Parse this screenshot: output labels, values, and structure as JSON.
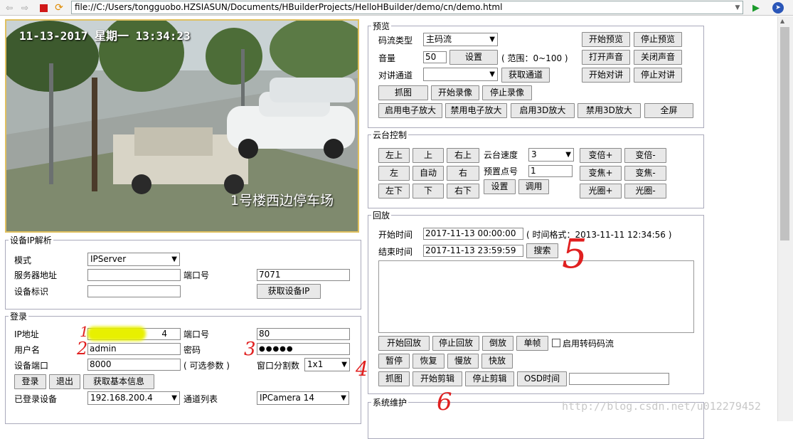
{
  "browser": {
    "url": "file://C:/Users/tongguobo.HZSIASUN/Documents/HBuilderProjects/HelloHBuilder/demo/cn/demo.html",
    "icons": [
      "back-arrow-icon",
      "forward-arrow-icon",
      "stop-icon",
      "refresh-icon",
      "dropdown-icon",
      "play-icon",
      "hbuilder-logo-icon"
    ]
  },
  "video": {
    "timestamp": "11-13-2017 星期一 13:34:23",
    "caption": "1号楼西边停车场"
  },
  "device_ip": {
    "legend": "设备IP解析",
    "mode_label": "模式",
    "mode_value": "IPServer",
    "server_label": "服务器地址",
    "server_value": "",
    "port_label": "端口号",
    "port_value": "7071",
    "id_label": "设备标识",
    "id_value": "",
    "get_ip_btn": "获取设备IP"
  },
  "login": {
    "legend": "登录",
    "ip_label": "IP地址",
    "ip_value": "4",
    "port_label": "端口号",
    "port_value": "80",
    "user_label": "用户名",
    "user_value": "admin",
    "pwd_label": "密码",
    "pwd_value": "●●●●●",
    "devport_label": "设备端口",
    "devport_value": "8000",
    "optional": "( 可选参数 )",
    "split_label": "窗口分割数",
    "split_value": "1x1",
    "login_btn": "登录",
    "logout_btn": "退出",
    "info_btn": "获取基本信息",
    "logged_label": "已登录设备",
    "logged_value": "192.168.200.4",
    "channel_label": "通道列表",
    "channel_value": "IPCamera 14"
  },
  "preview": {
    "legend": "预览",
    "stream_label": "码流类型",
    "stream_value": "主码流",
    "start_preview": "开始预览",
    "stop_preview": "停止预览",
    "volume_label": "音量",
    "volume_value": "50",
    "set_btn": "设置",
    "range": "( 范围：0~100 )",
    "open_sound": "打开声音",
    "close_sound": "关闭声音",
    "talk_label": "对讲通道",
    "talk_value": "",
    "get_channel": "获取通道",
    "start_talk": "开始对讲",
    "stop_talk": "停止对讲",
    "capture": "抓图",
    "start_rec": "开始录像",
    "stop_rec": "停止录像",
    "ezoom_on": "启用电子放大",
    "ezoom_off": "禁用电子放大",
    "zoom3d_on": "启用3D放大",
    "zoom3d_off": "禁用3D放大",
    "fullscreen": "全屏"
  },
  "ptz": {
    "legend": "云台控制",
    "upleft": "左上",
    "up": "上",
    "upright": "右上",
    "left": "左",
    "auto": "自动",
    "right": "右",
    "downleft": "左下",
    "down": "下",
    "downright": "右下",
    "speed_label": "云台速度",
    "speed_value": "3",
    "preset_label": "预置点号",
    "preset_value": "1",
    "set": "设置",
    "call": "调用",
    "zoom_in": "变倍+",
    "zoom_out": "变倍-",
    "focus_in": "变焦+",
    "focus_out": "变焦-",
    "iris_in": "光圈+",
    "iris_out": "光圈-"
  },
  "playback": {
    "legend": "回放",
    "start_label": "开始时间",
    "start_value": "2017-11-13 00:00:00",
    "format": "( 时间格式：2013-11-11 12:34:56 )",
    "end_label": "结束时间",
    "end_value": "2017-11-13 23:59:59",
    "search": "搜索",
    "start_play": "开始回放",
    "stop_play": "停止回放",
    "reverse": "倒放",
    "frame": "单帧",
    "transcode": "启用转码码流",
    "pause": "暂停",
    "resume": "恢复",
    "slow": "慢放",
    "fast": "快放",
    "capture": "抓图",
    "start_clip": "开始剪辑",
    "stop_clip": "停止剪辑",
    "osd": "OSD时间",
    "osd_value": ""
  },
  "maintenance": {
    "legend": "系统维护"
  },
  "annotations": [
    "1",
    "2",
    "3",
    "4",
    "5",
    "6"
  ],
  "watermark": "http://blog.csdn.net/u012279452"
}
